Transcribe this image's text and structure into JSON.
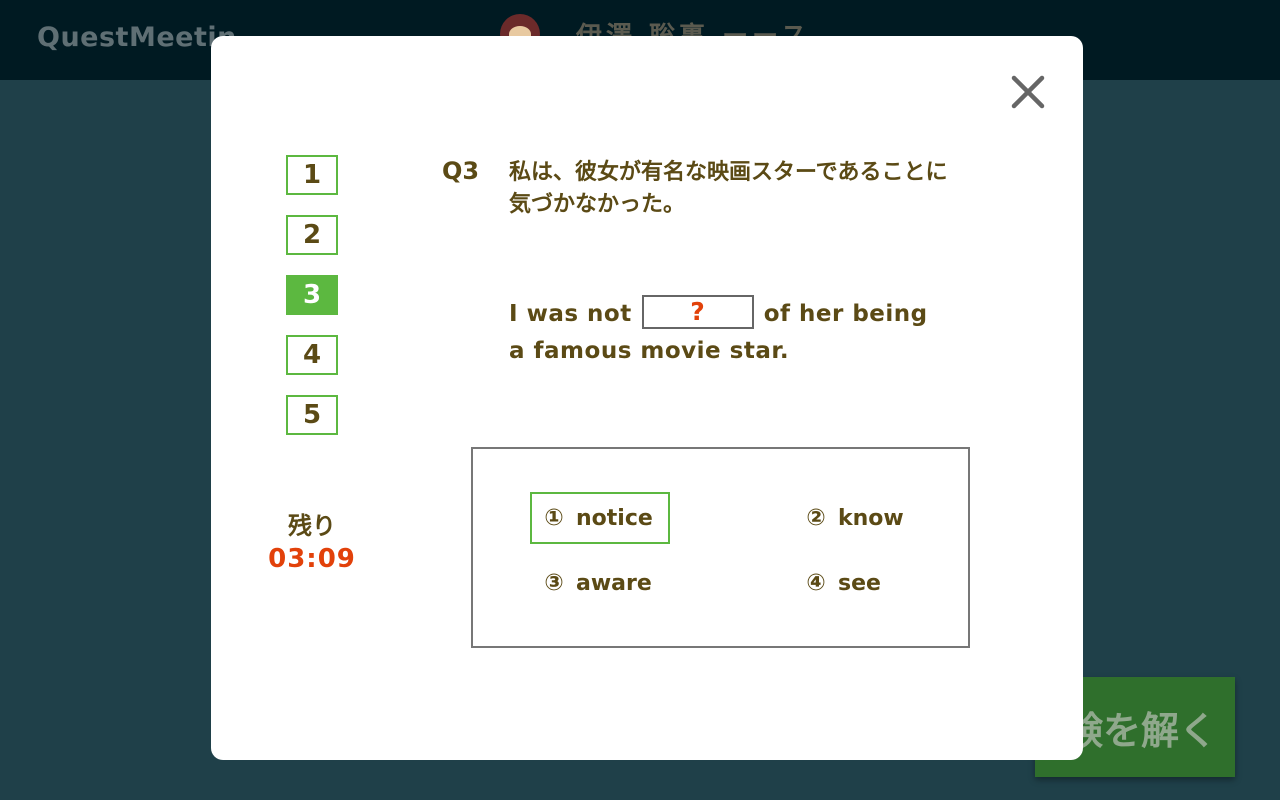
{
  "app": {
    "brand": "QuestMeetin",
    "user_name": "伊澤 聡裏 ーース",
    "solve_button_label": "験を解く"
  },
  "quiz": {
    "questions": [
      {
        "label": "1",
        "active": false
      },
      {
        "label": "2",
        "active": false
      },
      {
        "label": "3",
        "active": true
      },
      {
        "label": "4",
        "active": false
      },
      {
        "label": "5",
        "active": false
      }
    ],
    "remaining_label": "残り",
    "remaining_time": "03:09",
    "question_number": "Q3",
    "question_text": "私は、彼女が有名な映画スターであることに気づかなかった。",
    "sentence_before": "I was not",
    "blank_mark": "?",
    "sentence_after_line1": "of her being",
    "sentence_line2": "a famous movie star.",
    "choices": [
      {
        "num": "①",
        "text": "notice",
        "selected": true
      },
      {
        "num": "②",
        "text": "know",
        "selected": false
      },
      {
        "num": "③",
        "text": "aware",
        "selected": false
      },
      {
        "num": "④",
        "text": "see",
        "selected": false
      }
    ]
  },
  "colors": {
    "accent_green": "#5cb840",
    "text_brown": "#5b4a15",
    "timer_orange": "#e2410a",
    "background_teal": "#1f4049"
  },
  "icons": {
    "close": "close-icon",
    "avatar": "avatar"
  }
}
